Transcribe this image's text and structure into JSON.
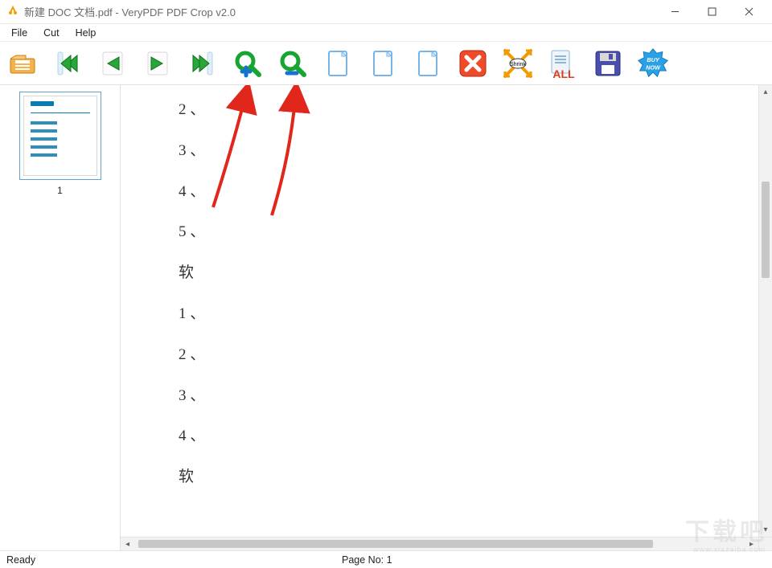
{
  "titlebar": {
    "title": "新建 DOC 文档.pdf - VeryPDF PDF Crop v2.0"
  },
  "menu": {
    "file": "File",
    "cut": "Cut",
    "help": "Help"
  },
  "toolbar": {
    "open": "open",
    "first": "first-page",
    "prev": "prev-page",
    "next": "next-page",
    "last": "last-page",
    "zoom_in": "zoom-in",
    "zoom_out": "zoom-out",
    "blank1": "blank-page-1",
    "blank2": "blank-page-2",
    "blank3": "blank-page-3",
    "delete": "delete",
    "shrink_label": "Shrink",
    "all_label": "ALL",
    "save": "save",
    "buy_label": "BUY NOW"
  },
  "sidebar": {
    "thumb_label": "1"
  },
  "document_lines": [
    "2 、",
    "3 、",
    "4 、",
    "5 、",
    "软",
    "1 、",
    "2 、",
    "3 、",
    "4 、",
    "软"
  ],
  "statusbar": {
    "ready": "Ready",
    "page": "Page No: 1"
  },
  "watermark": {
    "main": "下载吧",
    "sub": "www.xiazaiba.com"
  }
}
